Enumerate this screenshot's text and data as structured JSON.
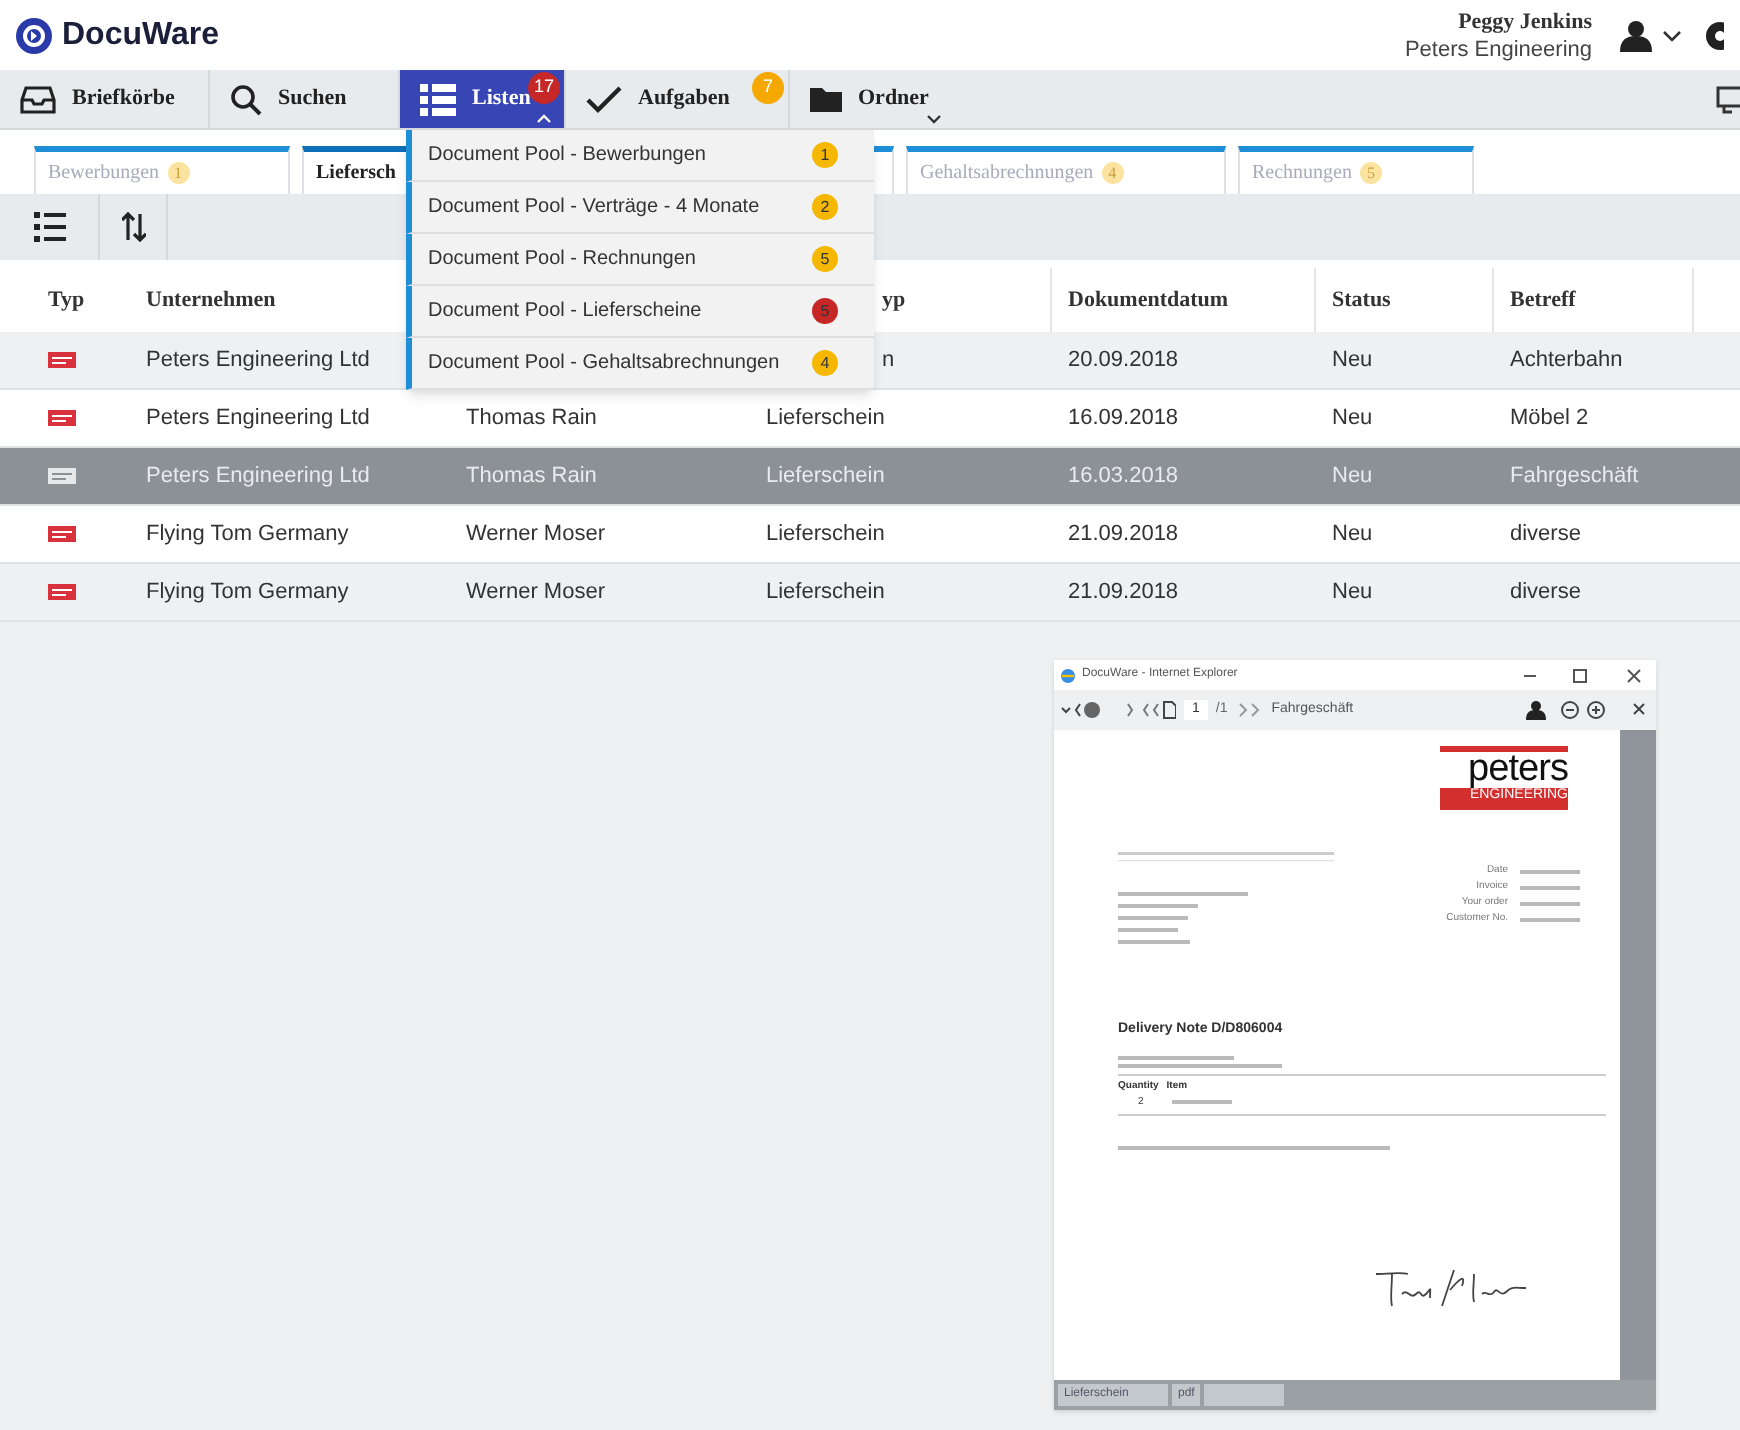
{
  "app": {
    "name": "DocuWare"
  },
  "user": {
    "name": "Peggy Jenkins",
    "company": "Peters Engineering"
  },
  "nav": [
    {
      "label": "Briefkörbe",
      "selected": false
    },
    {
      "label": "Suchen",
      "selected": false
    },
    {
      "label": "Listen",
      "selected": true,
      "badge": "17",
      "color": "#c62828",
      "expanded": true
    },
    {
      "label": "Aufgaben",
      "selected": false,
      "badge": "7",
      "color": "#f5a800"
    },
    {
      "label": "Ordner",
      "selected": false,
      "expanded": false
    }
  ],
  "menu": [
    {
      "label": "Document Pool - Bewerbungen",
      "badge": "1",
      "color": "#f5b700"
    },
    {
      "label": "Document Pool - Verträge - 4 Monate",
      "badge": "2",
      "color": "#f5b700"
    },
    {
      "label": "Document Pool - Rechnungen",
      "badge": "5",
      "color": "#f5b700"
    },
    {
      "label": "Document Pool - Lieferscheine",
      "badge": "5",
      "color": "#c62828"
    },
    {
      "label": "Document Pool - Gehaltsabrechnungen",
      "badge": "4",
      "color": "#f5b700"
    }
  ],
  "tabs": [
    {
      "label": "Bewerbungen",
      "badge": "1",
      "selected": false
    },
    {
      "label": "Liefersch",
      "selected": true
    },
    {
      "selected": false
    },
    {
      "label": "Gehaltsabrechnungen",
      "badge": "4",
      "selected": false
    },
    {
      "label": "Rechnungen",
      "badge": "5",
      "selected": false
    }
  ],
  "table": {
    "columns": [
      "Typ",
      "Unternehmen",
      null,
      "yp",
      "Dokumentdatum",
      "Status",
      "Betreff"
    ],
    "rows": [
      {
        "cells": [
          null,
          "Peters Engineering Ltd",
          null,
          "n",
          "20.09.2018",
          "Neu",
          "Achterbahn"
        ],
        "selected": false
      },
      {
        "cells": [
          null,
          "Peters Engineering Ltd",
          "Thomas Rain",
          "Lieferschein",
          "16.09.2018",
          "Neu",
          "Möbel 2"
        ],
        "selected": false
      },
      {
        "cells": [
          null,
          "Peters Engineering Ltd",
          "Thomas Rain",
          "Lieferschein",
          "16.03.2018",
          "Neu",
          "Fahrgeschäft"
        ],
        "selected": true
      },
      {
        "cells": [
          null,
          "Flying Tom Germany",
          "Werner Moser",
          "Lieferschein",
          "21.09.2018",
          "Neu",
          "diverse"
        ],
        "selected": false
      },
      {
        "cells": [
          null,
          "Flying Tom Germany",
          "Werner Moser",
          "Lieferschein",
          "21.09.2018",
          "Neu",
          "diverse"
        ],
        "selected": false
      }
    ]
  },
  "viewer": {
    "title": "DocuWare - Internet Explorer",
    "page": "1",
    "pages": "/1",
    "subject": "Fahrgeschäft",
    "logo": "peters",
    "logo_sub": "ENGINEERING",
    "meta": [
      "Date",
      "Invoice",
      "Your order",
      "Customer No."
    ],
    "heading": "Delivery Note D/D806004",
    "item_columns": [
      "Quantity",
      "Item"
    ],
    "quantity": "2",
    "status": [
      "Lieferschein",
      "pdf"
    ]
  }
}
